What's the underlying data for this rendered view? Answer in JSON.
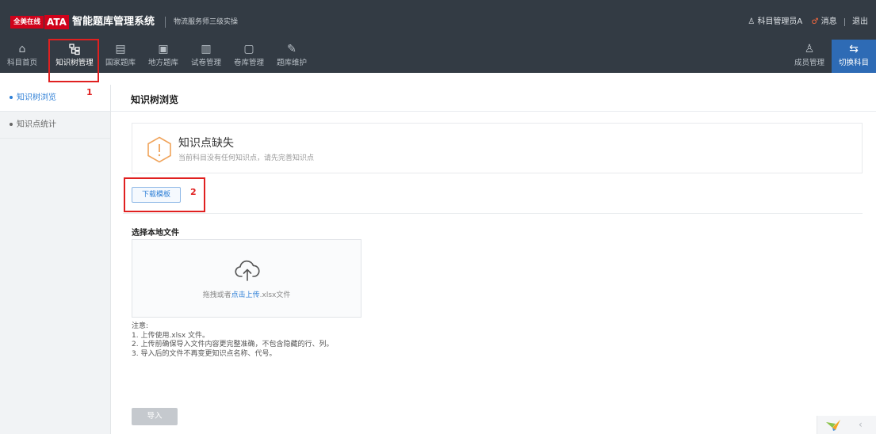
{
  "header": {
    "brand_badge": "全美在线",
    "brand_ata": "ATA",
    "app_title": "智能题库管理系统",
    "subtitle": "物流服务师三级实操",
    "user_name": "科目管理员A",
    "messages_label": "消息",
    "logout_label": "退出"
  },
  "nav": {
    "items": [
      {
        "label": "科目首页",
        "icon": "home-icon"
      },
      {
        "label": "知识树管理",
        "icon": "tree-icon"
      },
      {
        "label": "国家题库",
        "icon": "national-bank-icon"
      },
      {
        "label": "地方题库",
        "icon": "local-bank-icon"
      },
      {
        "label": "试卷管理",
        "icon": "paper-icon"
      },
      {
        "label": "卷库管理",
        "icon": "paper-bank-icon"
      },
      {
        "label": "题库维护",
        "icon": "maintenance-icon"
      }
    ],
    "right_items": [
      {
        "label": "成员管理",
        "icon": "members-icon"
      },
      {
        "label": "切换科目",
        "icon": "switch-icon"
      }
    ],
    "active_index": 1
  },
  "sidebar": {
    "items": [
      {
        "label": "知识树浏览",
        "active": true
      },
      {
        "label": "知识点统计",
        "active": false
      }
    ]
  },
  "main": {
    "page_title": "知识树浏览",
    "warning": {
      "title": "知识点缺失",
      "description": "当前科目没有任何知识点，请先完善知识点"
    },
    "download_button": "下载模板",
    "file_section_label": "选择本地文件",
    "dropzone": {
      "text_before": "拖拽或者",
      "link_text": "点击上传",
      "text_after": ".xlsx文件"
    },
    "notes": [
      "注意:",
      "1. 上传使用.xlsx 文件。",
      "2. 上传前确保导入文件内容更完整准确，不包含隐藏的行、列。",
      "3. 导入后的文件不再变更知识点名称、代号。"
    ],
    "import_button": "导入"
  },
  "annotations": [
    {
      "label": "1"
    },
    {
      "label": "2"
    }
  ],
  "colors": {
    "header_bg": "#333b44",
    "accent": "#2e7fd6",
    "switch_bg": "#2e6bb5",
    "brand_red": "#d0021b",
    "annotation_red": "#e02020",
    "warning_orange": "#f0a35a"
  }
}
